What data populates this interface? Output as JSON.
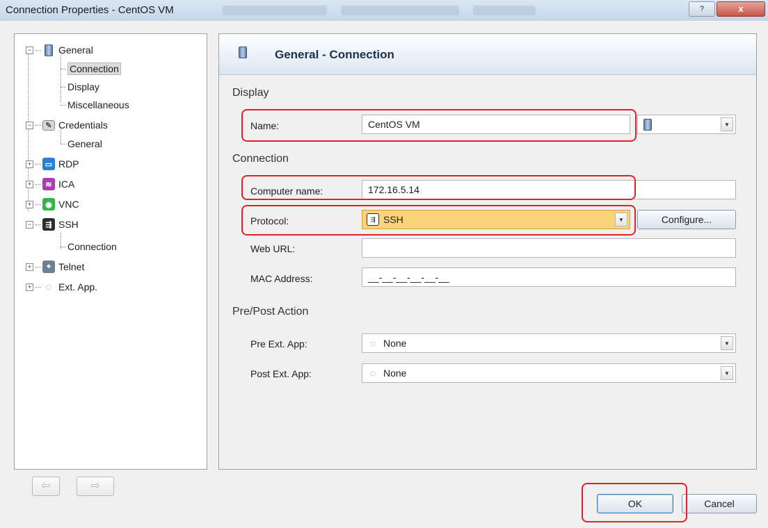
{
  "window": {
    "title": "Connection Properties - CentOS VM",
    "help_glyph": "?",
    "close_glyph": "x"
  },
  "tree": {
    "items": [
      {
        "label": "General",
        "expander": "−"
      },
      {
        "label": "Connection"
      },
      {
        "label": "Display"
      },
      {
        "label": "Miscellaneous"
      },
      {
        "label": "Credentials",
        "expander": "−"
      },
      {
        "label": "General"
      },
      {
        "label": "RDP",
        "expander": "+"
      },
      {
        "label": "ICA",
        "expander": "+"
      },
      {
        "label": "VNC",
        "expander": "+"
      },
      {
        "label": "SSH",
        "expander": "−"
      },
      {
        "label": "Connection"
      },
      {
        "label": "Telnet",
        "expander": "+"
      },
      {
        "label": "Ext. App.",
        "expander": "+"
      }
    ]
  },
  "panel": {
    "title": "General - Connection",
    "sections": {
      "display": "Display",
      "connection": "Connection",
      "prepost": "Pre/Post Action"
    },
    "fields": {
      "name_label": "Name:",
      "name_value": "CentOS VM",
      "computer_label": "Computer name:",
      "computer_value": "172.16.5.14",
      "protocol_label": "Protocol:",
      "protocol_value": "SSH",
      "configure_label": "Configure...",
      "weburl_label": "Web URL:",
      "weburl_value": "",
      "mac_label": "MAC Address:",
      "mac_value": "__-__-__-__-__-__",
      "pre_label": "Pre Ext. App:",
      "pre_value": "None",
      "post_label": "Post Ext. App:",
      "post_value": "None"
    }
  },
  "buttons": {
    "ok": "OK",
    "cancel": "Cancel",
    "back_glyph": "⇦",
    "forward_glyph": "⇨"
  },
  "colors": {
    "highlight": "#e0202a",
    "protocol_bg": "#fbd37a",
    "rdp": "#2b7fd0",
    "ica": "#a83fb0",
    "vnc": "#36b24a",
    "ssh": "#2d2d2d",
    "telnet": "#6c7f97"
  },
  "icons": {
    "dropdown": "▼"
  }
}
